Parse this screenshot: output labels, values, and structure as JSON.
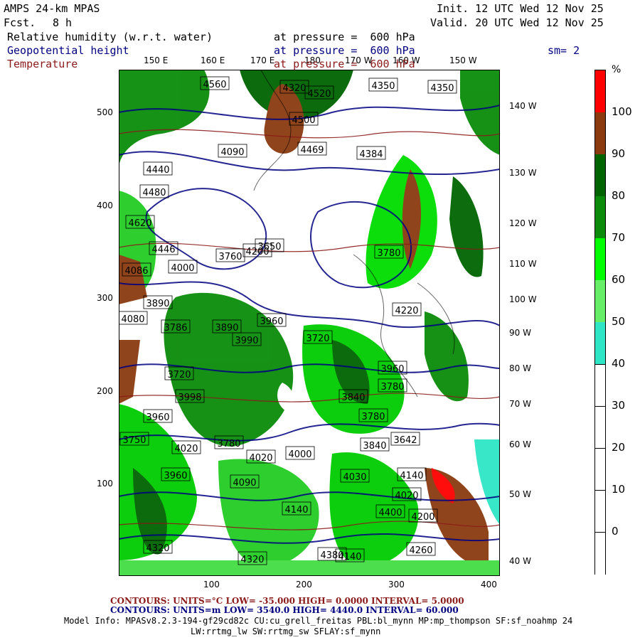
{
  "header": {
    "model": "AMPS 24-km MPAS",
    "fcst_label": "Fcst.",
    "fcst_value": "8 h",
    "init": "Init. 12 UTC Wed 12 Nov 25",
    "valid": "Valid. 20 UTC Wed 12 Nov 25",
    "smoothing": "sm= 2"
  },
  "fields": [
    {
      "name": "Relative humidity (w.r.t. water)",
      "level": "at pressure =  600 hPa"
    },
    {
      "name": "Geopotential height",
      "level": "at pressure =  600 hPa"
    },
    {
      "name": "Temperature",
      "level": "at pressure =  600 hPa"
    }
  ],
  "axes": {
    "y_ticks": [
      "500",
      "400",
      "300",
      "200",
      "100"
    ],
    "x_ticks": [
      "100",
      "200",
      "300",
      "400"
    ],
    "lon_top": [
      "150 E",
      "160 E",
      "170 E",
      "180",
      "170 W",
      "160 W",
      "150 W"
    ],
    "lon_right": [
      "140 W",
      "130 W",
      "120 W",
      "110 W",
      "100 W",
      "90 W",
      "80 W",
      "70 W",
      "60 W",
      "50 W",
      "40 W"
    ]
  },
  "colorbar": {
    "unit": "%",
    "labels": [
      "100",
      "90",
      "80",
      "70",
      "60",
      "50",
      "40",
      "30",
      "20",
      "10",
      "0"
    ],
    "colors": [
      "#ff0000",
      "#8b3a0f",
      "#006400",
      "#0a8c0a",
      "#00ff00",
      "#66ee66",
      "#2ee6c6",
      "#ffffff",
      "#ffffff",
      "#ffffff",
      "#ffffff"
    ]
  },
  "height_labels": [
    "4560",
    "4320",
    "4350",
    "4350",
    "4520",
    "4500",
    "4469",
    "4384",
    "4090",
    "4440",
    "4480",
    "4620",
    "4086",
    "4446",
    "4080",
    "4000",
    "4200",
    "3760",
    "3650",
    "3780",
    "3720",
    "3960",
    "4220",
    "3786",
    "3890",
    "3890",
    "3990",
    "3780",
    "3720",
    "3998",
    "3780",
    "3960",
    "3840",
    "3780",
    "3642",
    "3750",
    "3960",
    "4020",
    "3840",
    "4000",
    "4020",
    "4030",
    "4140",
    "4020",
    "4090",
    "3960",
    "4140",
    "4400",
    "4200",
    "4140",
    "4260",
    "4380",
    "4320",
    "4320"
  ],
  "footer": {
    "temp_contours": "CONTOURS:  UNITS=°C  LOW= -35.000      HIGH=  0.0000      INTERVAL=   5.0000",
    "height_contours": "CONTOURS:  UNITS=m  LOW=  3540.0      HIGH=  4440.0      INTERVAL=   60.000",
    "model_info_1": "Model Info: MPASv8.2.3-194-gf29cd82c CU:cu_grell_freitas PBL:bl_mynn MP:mp_thompson SF:sf_noahmp 24",
    "model_info_2": "LW:rrtmg_lw SW:rrtmg_sw SFLAY:sf_mynn"
  }
}
